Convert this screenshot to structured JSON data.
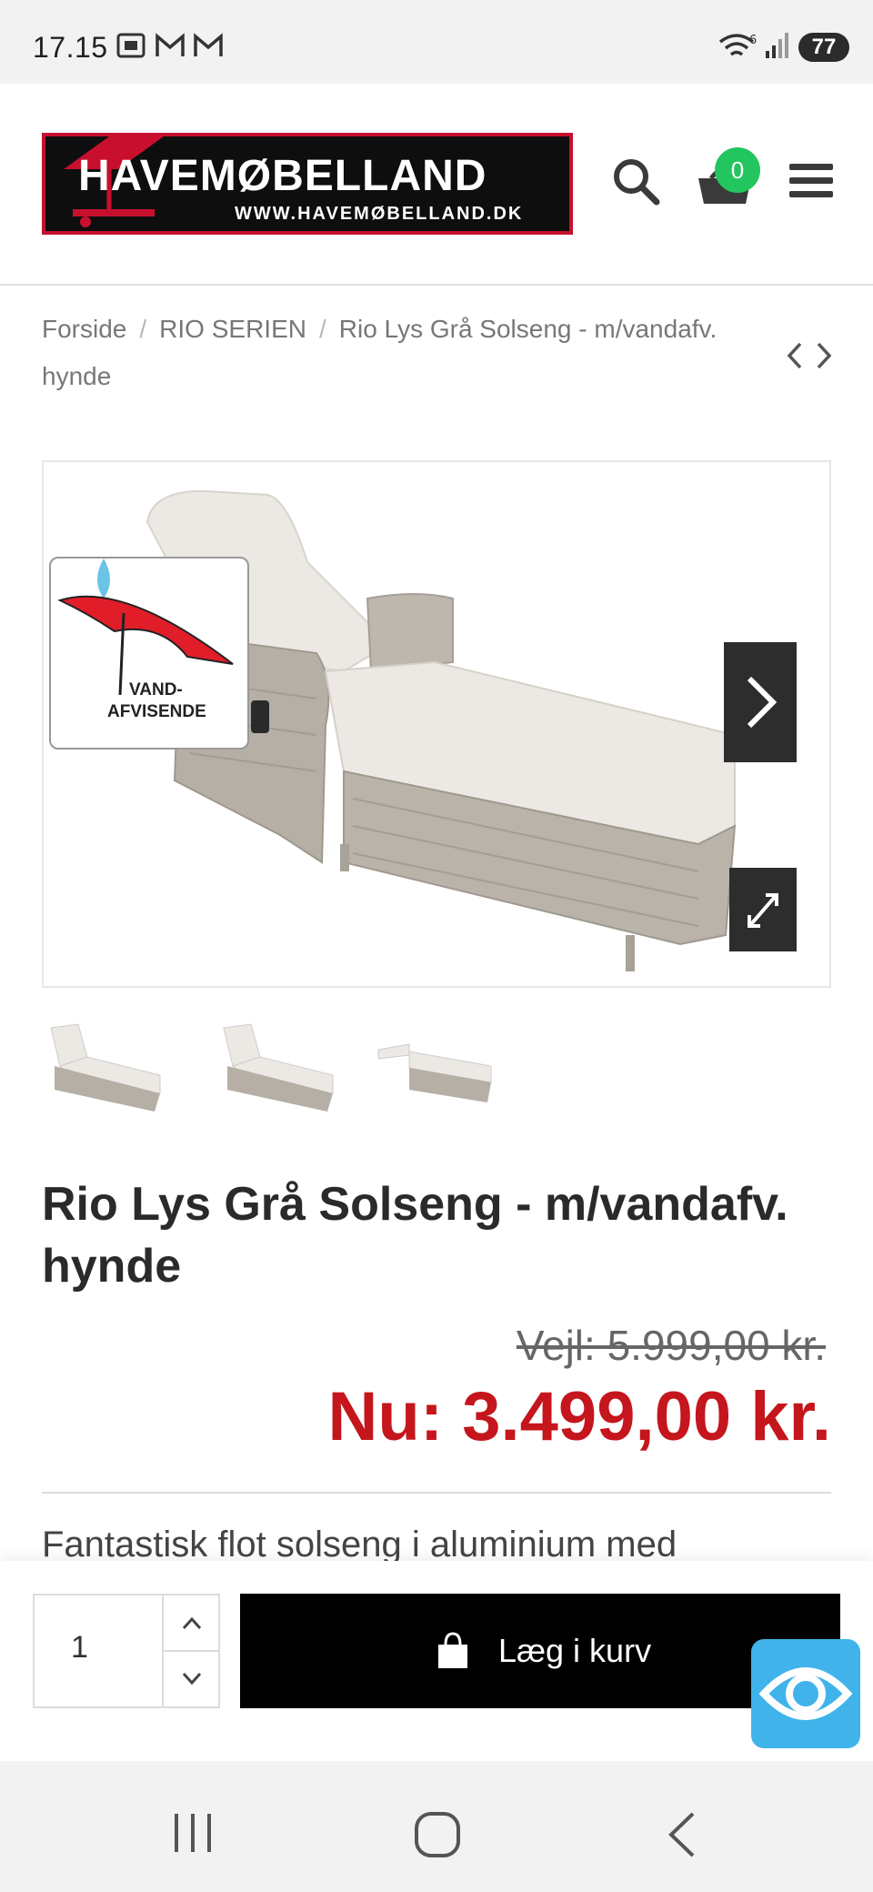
{
  "status_bar": {
    "time": "17.15",
    "battery": "77",
    "left_icons": [
      "screenshot-icon",
      "gmail-icon",
      "gmail-icon"
    ],
    "right_icons": [
      "wifi-icon",
      "signal-icon",
      "battery-icon"
    ],
    "wifi_label": "6"
  },
  "header": {
    "logo_name": "HAVEMØBELLAND",
    "logo_url": "WWW.HAVEMØBELLAND.DK",
    "cart_count": "0",
    "icons": [
      "search-icon",
      "cart-icon",
      "menu-icon"
    ]
  },
  "breadcrumb": {
    "home": "Forside",
    "category": "RIO SERIEN",
    "current": "Rio Lys Grå Solseng - m/vandafv. hynde",
    "separator": "/",
    "nav_icon": "prev-next-icon"
  },
  "gallery": {
    "badge_text_1": "VAND-",
    "badge_text_2": "AFVISENDE",
    "thumb_count": 3
  },
  "product": {
    "title": "Rio Lys Grå Solseng - m/vandafv. hynde",
    "old_price": "Vejl: 5.999,00 kr.",
    "new_price": "Nu: 3.499,00 kr.",
    "description": "Fantastisk flot solseng i aluminium med"
  },
  "cart": {
    "quantity": "1",
    "add_label": "Læg i kurv"
  },
  "colors": {
    "accent_red": "#c4161c",
    "cart_badge": "#22c55e",
    "eye_button": "#3fb3ea"
  }
}
